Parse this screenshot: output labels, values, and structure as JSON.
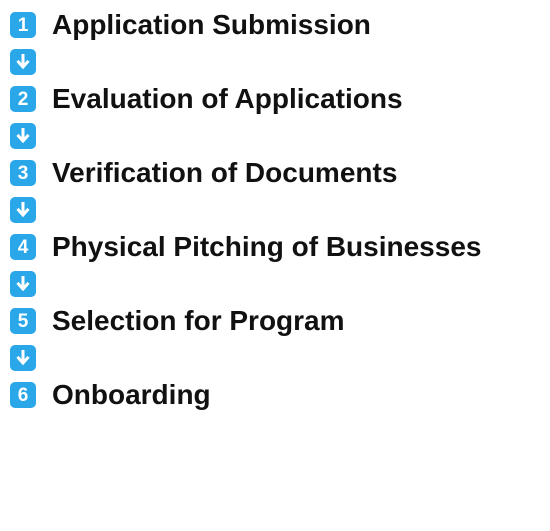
{
  "colors": {
    "badge": "#2aa7e8",
    "badge_text": "#ffffff",
    "label_text": "#111111"
  },
  "steps": [
    {
      "number": "1",
      "label": "Application Submission"
    },
    {
      "number": "2",
      "label": "Evaluation of Applications"
    },
    {
      "number": "3",
      "label": "Verification of Documents"
    },
    {
      "number": "4",
      "label": "Physical Pitching of Businesses"
    },
    {
      "number": "5",
      "label": "Selection for Program"
    },
    {
      "number": "6",
      "label": "Onboarding"
    }
  ],
  "connector_icon": "arrow-down-icon"
}
